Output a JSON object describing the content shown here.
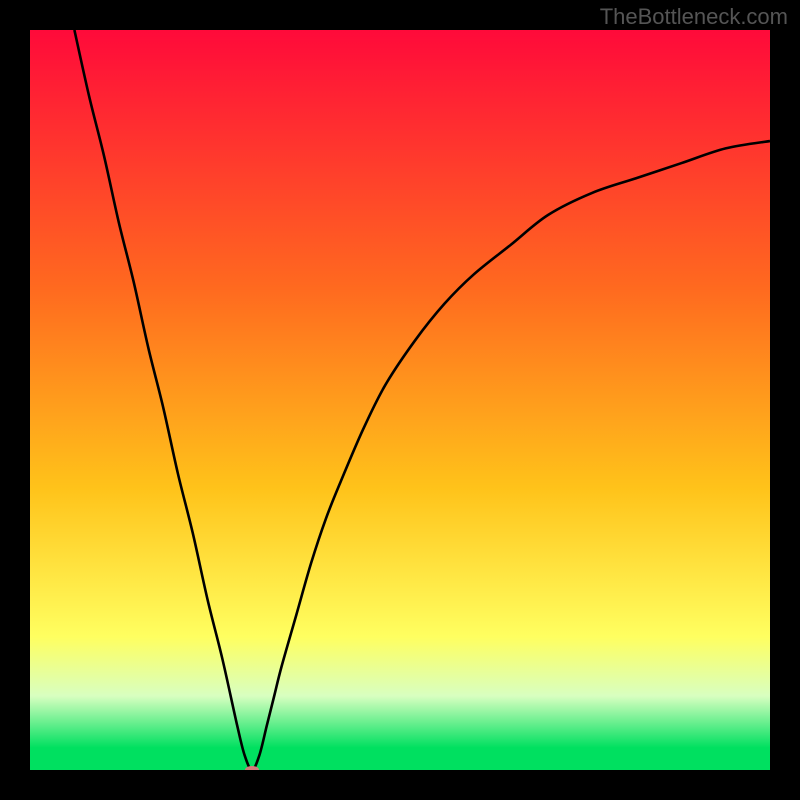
{
  "watermark": "TheBottleneck.com",
  "chart_data": {
    "type": "line",
    "title": "",
    "xlabel": "",
    "ylabel": "",
    "xlim": [
      0,
      100
    ],
    "ylim": [
      0,
      100
    ],
    "gradient_colors": {
      "top": "#ff0a3a",
      "upper": "#ff6a1f",
      "mid": "#ffc31a",
      "lower": "#ffff60",
      "pale": "#d8ffc0",
      "green": "#00e060"
    },
    "gradient_stops": [
      0,
      35,
      62,
      82,
      90,
      97
    ],
    "series": [
      {
        "name": "curve",
        "color": "#000000",
        "x": [
          6,
          8,
          10,
          12,
          14,
          16,
          18,
          20,
          22,
          24,
          26,
          28,
          29,
          30,
          31,
          32,
          33,
          34,
          36,
          38,
          40,
          42,
          45,
          48,
          52,
          56,
          60,
          65,
          70,
          76,
          82,
          88,
          94,
          100
        ],
        "y": [
          100,
          91,
          83,
          74,
          66,
          57,
          49,
          40,
          32,
          23,
          15,
          6,
          2,
          0,
          2,
          6,
          10,
          14,
          21,
          28,
          34,
          39,
          46,
          52,
          58,
          63,
          67,
          71,
          75,
          78,
          80,
          82,
          84,
          85
        ]
      }
    ],
    "marker": {
      "x": 30,
      "y": 0,
      "color": "#d07a7a",
      "rx": 7,
      "ry": 4
    }
  }
}
